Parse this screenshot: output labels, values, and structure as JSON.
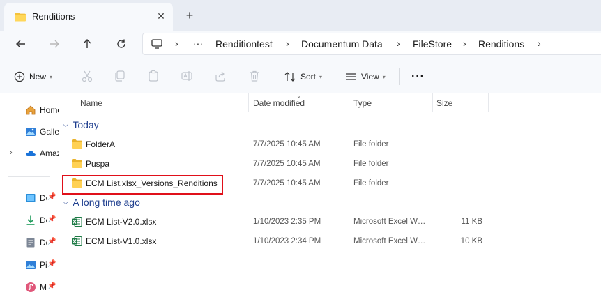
{
  "tab": {
    "title": "Renditions",
    "close_icon": "✕",
    "add_icon": "+"
  },
  "address": {
    "crumbs": [
      "Renditiontest",
      "Documentum Data",
      "FileStore",
      "Renditions"
    ],
    "ellipsis": "···"
  },
  "commands": {
    "new_label": "New",
    "sort_label": "Sort",
    "view_label": "View",
    "more": "···"
  },
  "sidebar": {
    "items": [
      {
        "label": "Home",
        "icon": "home-icon"
      },
      {
        "label": "Gallery",
        "icon": "gallery-icon"
      },
      {
        "label": "Amazon",
        "icon": "cloud-icon"
      },
      {
        "label": "Desktop",
        "icon": "desktop-icon"
      },
      {
        "label": "Downloads",
        "icon": "download-icon"
      },
      {
        "label": "Documents",
        "icon": "document-icon"
      },
      {
        "label": "Pictures",
        "icon": "pictures-icon"
      },
      {
        "label": "Music",
        "icon": "music-icon"
      }
    ],
    "pin": "📌"
  },
  "columns": {
    "name": "Name",
    "date": "Date modified",
    "type": "Type",
    "size": "Size"
  },
  "groups": [
    {
      "title": "Today",
      "rows": [
        {
          "name": "FolderA",
          "date": "7/7/2025 10:45 AM",
          "type": "File folder",
          "size": ""
        },
        {
          "name": "Puspa",
          "date": "7/7/2025 10:45 AM",
          "type": "File folder",
          "size": ""
        },
        {
          "name": "ECM List.xlsx_Versions_Renditions",
          "date": "7/7/2025 10:45 AM",
          "type": "File folder",
          "size": ""
        }
      ]
    },
    {
      "title": "A long time ago",
      "rows": [
        {
          "name": "ECM List-V2.0.xlsx",
          "date": "1/10/2023 2:35 PM",
          "type": "Microsoft Excel Worksheet",
          "size": "11 KB"
        },
        {
          "name": "ECM List-V1.0.xlsx",
          "date": "1/10/2023 2:34 PM",
          "type": "Microsoft Excel Worksheet",
          "size": "10 KB"
        }
      ]
    }
  ],
  "colors": {
    "accent": "#1f3f8f",
    "highlight": "#e0101a",
    "folder": "#f4c23c"
  }
}
